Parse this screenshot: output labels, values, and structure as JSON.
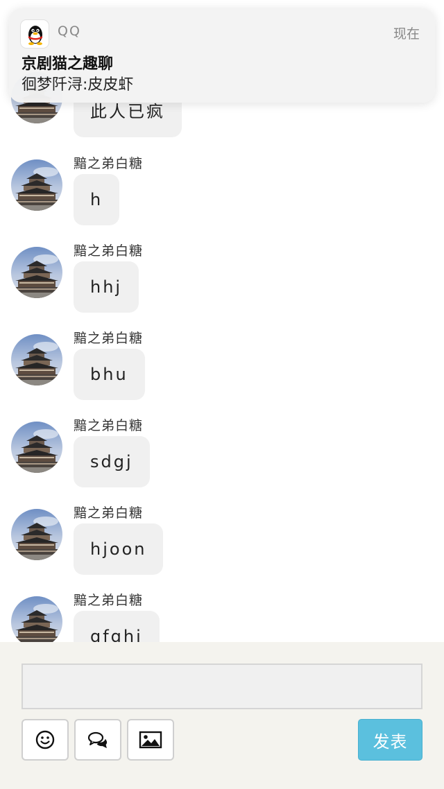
{
  "notification": {
    "app_name": "QQ",
    "time": "现在",
    "title": "京剧猫之趣聊",
    "body": "徊梦阡浔:皮皮虾",
    "icon": "qq-penguin-icon"
  },
  "messages": [
    {
      "sender": "",
      "text": "此人已疯"
    },
    {
      "sender": "黯之弟白糖",
      "text": "h"
    },
    {
      "sender": "黯之弟白糖",
      "text": "hhj"
    },
    {
      "sender": "黯之弟白糖",
      "text": "bhu"
    },
    {
      "sender": "黯之弟白糖",
      "text": "sdgj"
    },
    {
      "sender": "黯之弟白糖",
      "text": "hjoon"
    },
    {
      "sender": "黯之弟白糖",
      "text": "gfghj"
    }
  ],
  "input": {
    "value": "",
    "placeholder": ""
  },
  "toolbar": {
    "emoji_icon": "smiley-icon",
    "chat_icon": "chat-bubbles-icon",
    "image_icon": "image-icon",
    "send_label": "发表"
  },
  "colors": {
    "send_button": "#5bc0de",
    "bubble": "#f0f0f0",
    "input_bar": "#f4f3ee"
  }
}
